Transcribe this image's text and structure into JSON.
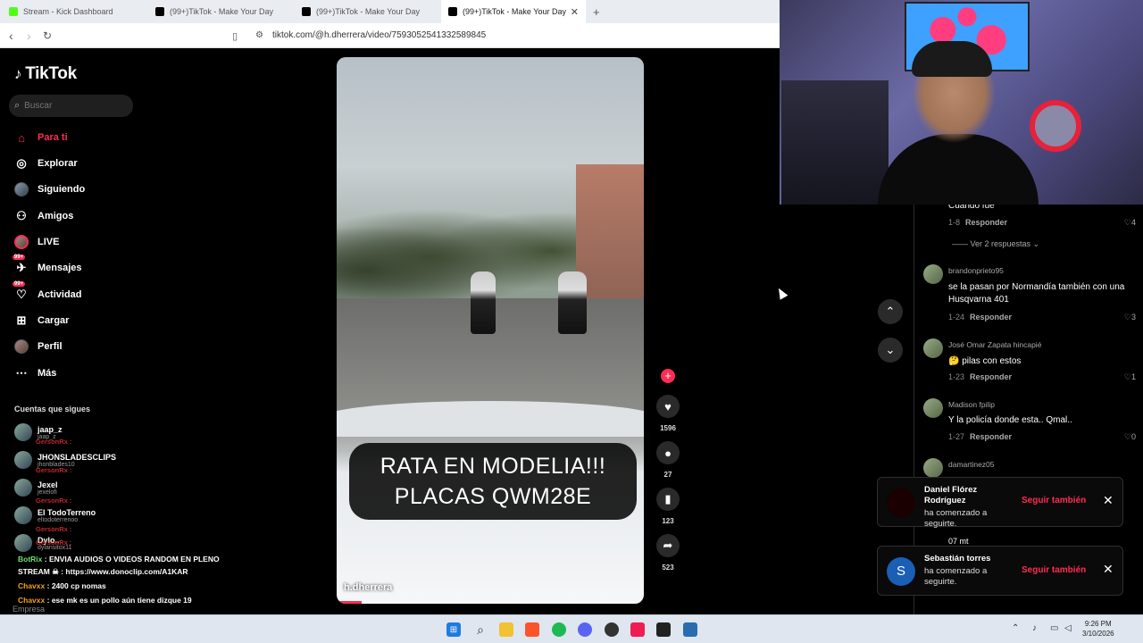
{
  "browser": {
    "tabs": [
      {
        "label": "Stream - Kick Dashboard",
        "active": false,
        "favicon_color": "#53fc18"
      },
      {
        "label": "(99+)TikTok - Make Your Day",
        "active": false,
        "favicon_color": "#000000"
      },
      {
        "label": "(99+)TikTok - Make Your Day",
        "active": false,
        "favicon_color": "#000000"
      },
      {
        "label": "(99+)TikTok - Make Your Day",
        "active": true,
        "favicon_color": "#000000"
      }
    ],
    "new_tab": "+",
    "close_tab": "✕",
    "url": "tiktok.com/@h.dherrera/video/7593052541332589845"
  },
  "sidebar": {
    "logo": "TikTok",
    "search_placeholder": "Buscar",
    "nav": [
      {
        "label": "Para ti",
        "icon": "home-icon",
        "active": true
      },
      {
        "label": "Explorar",
        "icon": "compass-icon"
      },
      {
        "label": "Siguiendo",
        "icon": "avatar"
      },
      {
        "label": "Amigos",
        "icon": "friends-icon"
      },
      {
        "label": "LIVE",
        "icon": "live-icon"
      },
      {
        "label": "Mensajes",
        "icon": "messages-icon",
        "badge": "99+"
      },
      {
        "label": "Actividad",
        "icon": "activity-icon",
        "badge": "99+"
      },
      {
        "label": "Cargar",
        "icon": "upload-icon"
      },
      {
        "label": "Perfil",
        "icon": "profile-icon"
      },
      {
        "label": "Más",
        "icon": "more-icon"
      }
    ],
    "following_title": "Cuentas que sigues",
    "following": [
      {
        "name": "jaap_z",
        "handle": "jaap_z"
      },
      {
        "name": "JHONSLADESCLIPS",
        "handle": "jhonblades10"
      },
      {
        "name": "Jexel",
        "handle": "jexelofi"
      },
      {
        "name": "El TodoTerreno",
        "handle": "eltodoterrenoo"
      },
      {
        "name": "Dylo..",
        "handle": "dylansitox11"
      }
    ],
    "footer": "Empresa"
  },
  "chat": {
    "ghost_names": [
      "GersonRx :",
      "GersonRx :",
      "GersonRx :",
      "GersonRx :",
      "GersonRx :"
    ],
    "lines": [
      {
        "user": "BotRix",
        "text": ": ENVIA AUDIOS O VIDEOS RANDOM EN PLENO"
      },
      {
        "user": "",
        "text": "STREAM ☠ : https://www.donoclip.com/A1KAR"
      },
      {
        "user": "Chavxx",
        "text": ": 2400 cp nomas"
      },
      {
        "user": "Chavxx",
        "text": ": ese mk es un pollo aún tiene dizque 19"
      }
    ]
  },
  "video": {
    "caption_line1": "RATA EN MODELIA!!!",
    "caption_line2": "PLACAS QWM28E",
    "author": "h.dherrera",
    "progress": 0.08
  },
  "actions": {
    "likes": "1596",
    "comments": "27",
    "saves": "123",
    "shares": "523"
  },
  "comments": {
    "top_partial": {
      "text": "Cuando fue",
      "date": "1-8",
      "reply": "Responder",
      "likes": "4"
    },
    "view_replies": "Ver 2 respuestas",
    "items": [
      {
        "name": "brandonprieto95",
        "text": "se la pasan por Normandía también con una Husqvarna 401",
        "date": "1-24",
        "reply": "Responder",
        "likes": "3"
      },
      {
        "name": "José Omar Zapata hincapié",
        "text": "🤔 pilas con estos",
        "date": "1-23",
        "reply": "Responder",
        "likes": "1"
      },
      {
        "name": "Madison fpilip",
        "text": "Y la policía donde esta.. Qmal..",
        "date": "1-27",
        "reply": "Responder",
        "likes": "0"
      },
      {
        "name": "damartinez05",
        "text": "",
        "date": "",
        "reply": "",
        "likes": ""
      }
    ],
    "partial_text": "07 mt"
  },
  "notifications": [
    {
      "name": "Daniel Flórez Rodríguez",
      "message": "ha comenzado a seguirte.",
      "button": "Seguir también",
      "avatar_letter": "",
      "avatar_color": "#1a0000"
    },
    {
      "name": "Sebastián torres",
      "message": "ha comenzado a seguirte.",
      "button": "Seguir también",
      "avatar_letter": "S",
      "avatar_color": "#1a5fb4"
    }
  ],
  "taskbar": {
    "time": "9:26 PM",
    "date": "3/10/2026"
  }
}
